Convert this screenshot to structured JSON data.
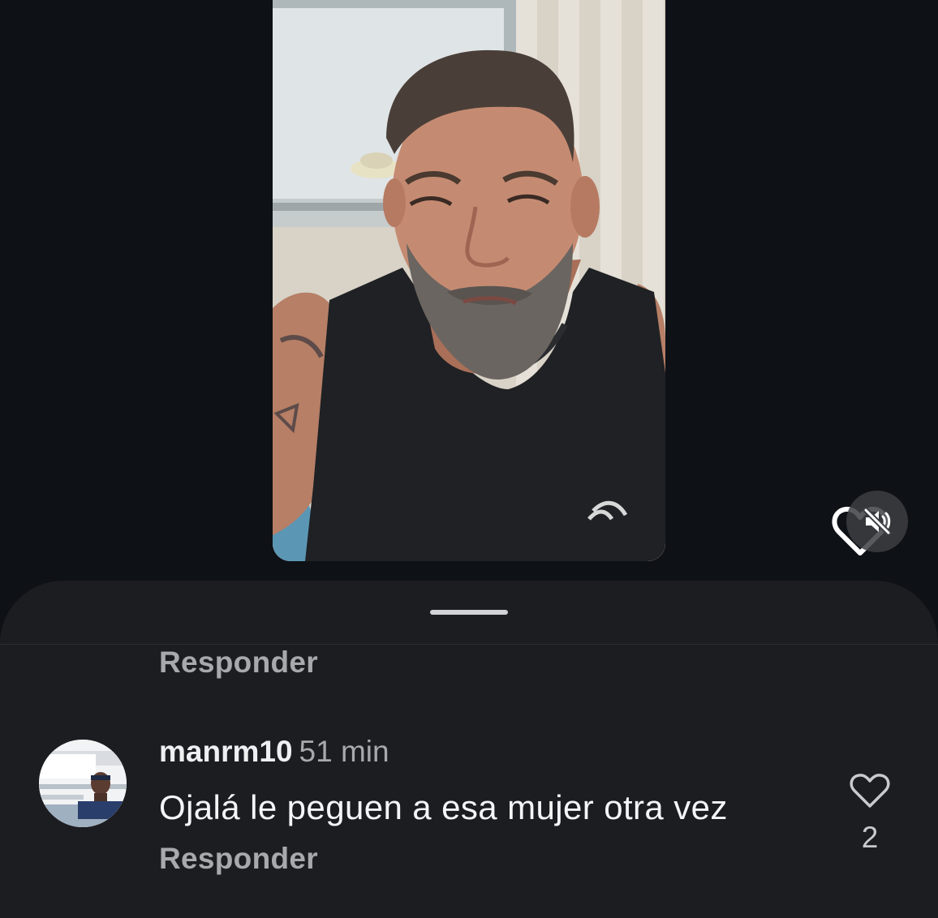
{
  "video": {
    "mute_icon": "speaker-muted-icon",
    "overlay_icon": "heart-outline-icon"
  },
  "comments": {
    "previous_reply_label": "Responder",
    "items": [
      {
        "username": "manrm10",
        "time": "51 min",
        "text": "Ojalá le peguen a esa mujer otra vez",
        "like_icon": "heart-outline-icon",
        "like_count": "2",
        "reply_label": "Responder"
      }
    ]
  },
  "colors": {
    "background": "#0e1116",
    "sheet": "#1c1d21",
    "secondary_text": "#a7a9ad",
    "primary_text": "#f4f5f7"
  }
}
